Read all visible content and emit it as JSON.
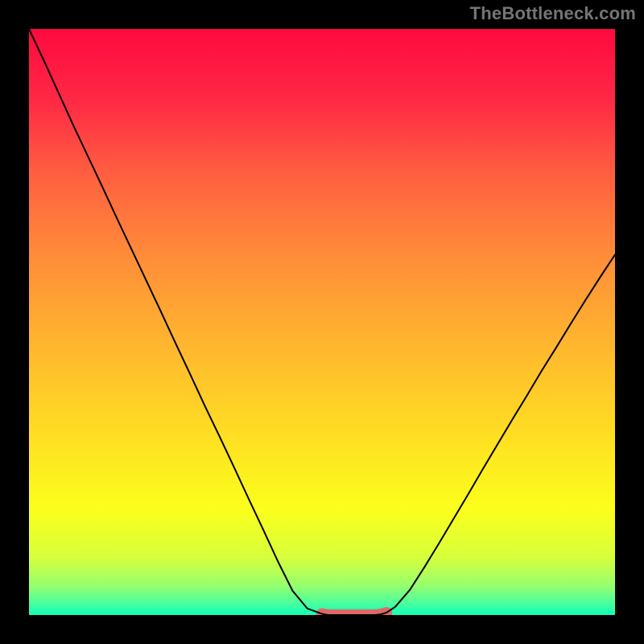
{
  "watermark": {
    "text": "TheBottleneck.com"
  },
  "chart_data": {
    "type": "line",
    "title": "",
    "xlabel": "",
    "ylabel": "",
    "xlim": [
      0,
      100
    ],
    "ylim": [
      0,
      100
    ],
    "grid": false,
    "legend": false,
    "series": [
      {
        "name": "bottleneck-curve",
        "x": [
          0,
          2.5,
          5,
          7.5,
          10,
          12.5,
          15,
          17.5,
          20,
          22.5,
          25,
          27.5,
          30,
          32.5,
          35,
          37.5,
          40,
          42.5,
          45,
          47.5,
          50,
          51,
          52,
          53,
          54,
          55,
          56,
          57,
          58,
          59,
          60,
          61,
          62.5,
          65,
          67.5,
          70,
          72.5,
          75,
          77.5,
          80,
          82.5,
          85,
          87.5,
          90,
          92.5,
          95,
          97.5,
          100
        ],
        "y": [
          100,
          94.7,
          89.2,
          83.7,
          78.4,
          73.1,
          67.7,
          62.4,
          57.1,
          51.8,
          46.4,
          41.1,
          35.7,
          30.5,
          25.2,
          19.8,
          14.5,
          9.1,
          4.1,
          1.1,
          0.2,
          0.0,
          0.0,
          0.0,
          0.0,
          0.0,
          0.0,
          0.0,
          0.0,
          0.0,
          0.1,
          0.4,
          1.4,
          4.3,
          8.2,
          12.3,
          16.5,
          20.7,
          25.0,
          29.2,
          33.4,
          37.5,
          41.7,
          45.7,
          49.8,
          53.8,
          57.7,
          61.5
        ]
      },
      {
        "name": "highlight-band",
        "x": [
          50,
          51,
          52,
          53,
          54,
          55,
          56,
          57,
          58,
          59,
          60,
          61
        ],
        "y": [
          0.2,
          0.0,
          0.0,
          0.0,
          0.0,
          0.0,
          0.0,
          0.0,
          0.0,
          0.0,
          0.1,
          0.4
        ]
      }
    ],
    "background_gradient": {
      "stops": [
        {
          "offset": 0.0,
          "color": "#ff0a3f"
        },
        {
          "offset": 0.12,
          "color": "#ff2845"
        },
        {
          "offset": 0.25,
          "color": "#ff6040"
        },
        {
          "offset": 0.4,
          "color": "#ff9038"
        },
        {
          "offset": 0.55,
          "color": "#ffb92e"
        },
        {
          "offset": 0.7,
          "color": "#ffe022"
        },
        {
          "offset": 0.82,
          "color": "#fbff1c"
        },
        {
          "offset": 0.9,
          "color": "#d8ff3a"
        },
        {
          "offset": 0.95,
          "color": "#96ff6e"
        },
        {
          "offset": 0.98,
          "color": "#4aff9e"
        },
        {
          "offset": 1.0,
          "color": "#11ffb8"
        }
      ]
    },
    "styles": {
      "curve_color": "#000000",
      "curve_width": 2,
      "highlight_color": "#e06868",
      "highlight_width": 14
    }
  }
}
